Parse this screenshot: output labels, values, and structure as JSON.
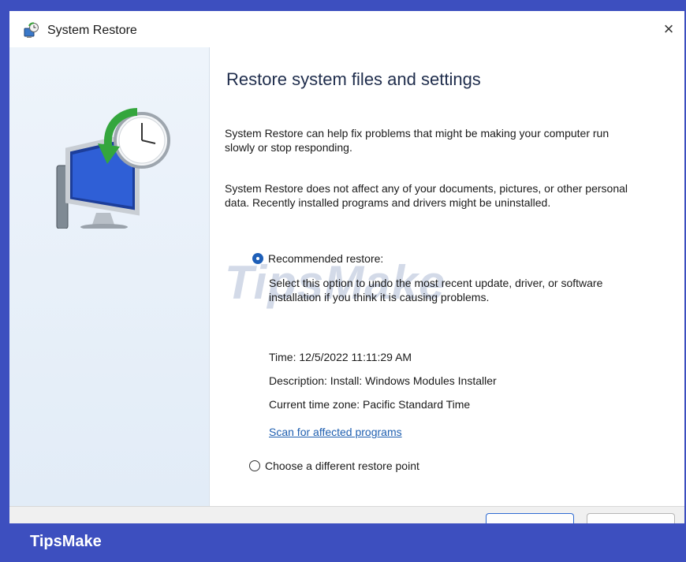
{
  "window": {
    "title": "System Restore",
    "close_glyph": "×"
  },
  "icons": {
    "app": "system-restore-icon",
    "close": "close-icon",
    "illustration": "monitor-restore-clock-icon"
  },
  "content": {
    "heading": "Restore system files and settings",
    "paragraph1": "System Restore can help fix problems that might be making your computer run slowly or stop responding.",
    "paragraph2": "System Restore does not affect any of your documents, pictures, or other personal data. Recently installed programs and drivers might be uninstalled.",
    "recommended": {
      "label": "Recommended restore:",
      "selected": true,
      "description": "Select this option to undo the most recent update, driver, or software installation if you think it is causing problems.",
      "time": "Time: 12/5/2022 11:11:29 AM",
      "desc": "Description: Install: Windows Modules Installer",
      "timezone": "Current time zone: Pacific Standard Time",
      "scan_link": "Scan for affected programs"
    },
    "different": {
      "label": "Choose a different restore point",
      "selected": false
    }
  },
  "watermark": "TipsMake",
  "brand": "TipsMake",
  "colors": {
    "accent": "#1e5fb8",
    "brand_bar": "#3d4fbf",
    "link": "#1f5fb0"
  }
}
